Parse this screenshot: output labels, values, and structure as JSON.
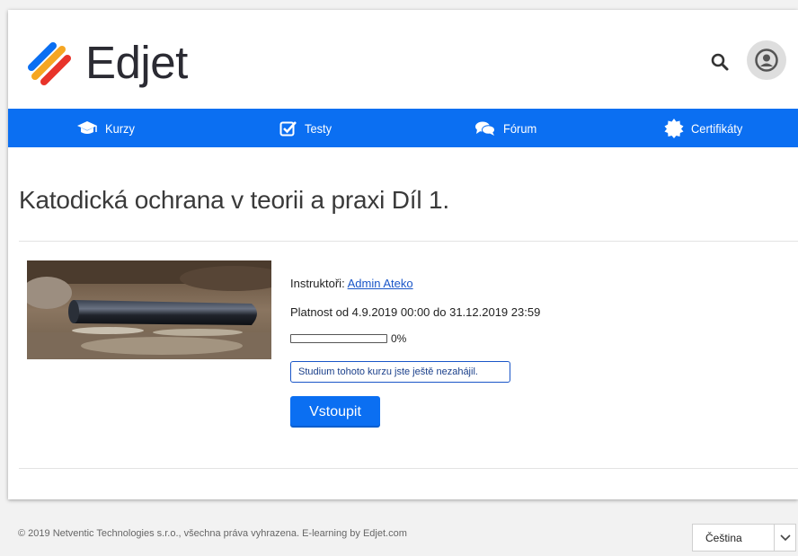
{
  "brand": {
    "name": "Edjet",
    "accent": "#0b6ff2",
    "logo_colors": [
      "#f5a623",
      "#e8332a",
      "#0b6ff2"
    ]
  },
  "header_icons": [
    "search-icon",
    "user-avatar-icon"
  ],
  "nav": {
    "items": [
      {
        "label": "Kurzy",
        "icon": "graduation-cap-icon"
      },
      {
        "label": "Testy",
        "icon": "check-square-icon"
      },
      {
        "label": "Fórum",
        "icon": "comments-icon"
      },
      {
        "label": "Certifikáty",
        "icon": "certificate-icon"
      }
    ]
  },
  "course": {
    "title": "Katodická ochrana v teorii a praxi Díl 1.",
    "instructors_label": "Instruktoři:",
    "instructor_name": "Admin Ateko",
    "validity": "Platnost od 4.9.2019 00:00 do 31.12.2019 23:59",
    "progress_value": 0,
    "progress_text": "0%",
    "status": "Studium tohoto kurzu jste ještě nezahájil.",
    "enter_label": "Vstoupit"
  },
  "footer": {
    "copyright": "© 2019 Netventic Technologies s.r.o., všechna práva vyhrazena. E-learning by Edjet.com",
    "language": "Čeština"
  }
}
